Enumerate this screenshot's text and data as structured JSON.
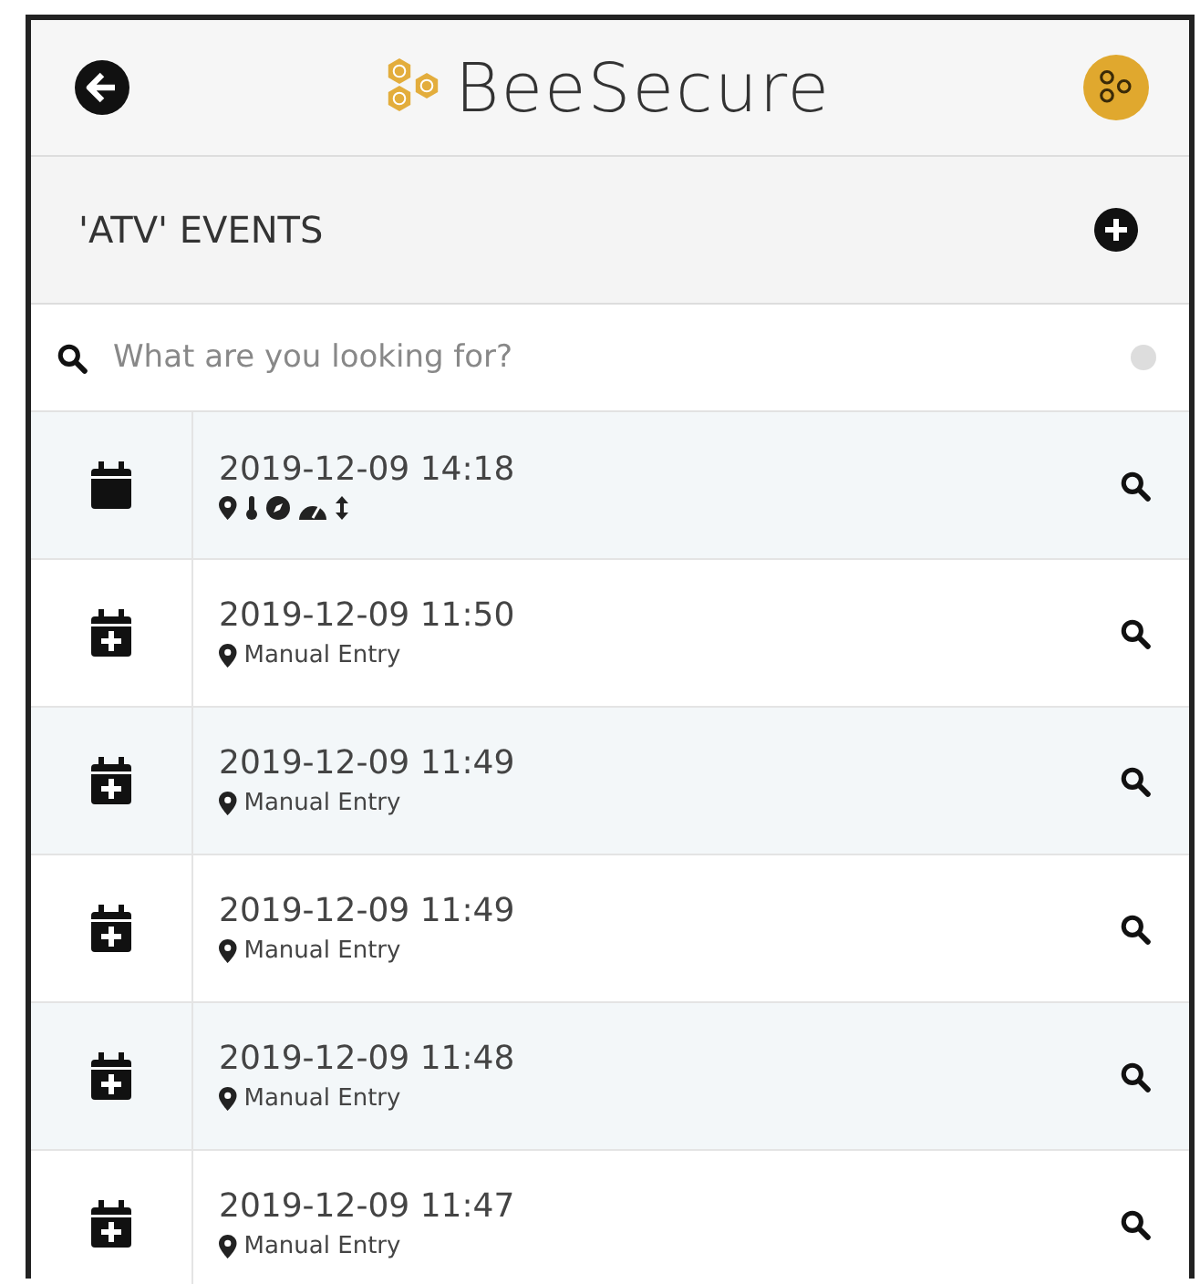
{
  "app": {
    "title": "BeeSecure"
  },
  "section": {
    "title": "'ATV' EVENTS"
  },
  "search": {
    "placeholder": "What are you looking for?"
  },
  "events": [
    {
      "kind": "sensor",
      "time": "2019-12-09 14:18"
    },
    {
      "kind": "manual",
      "time": "2019-12-09 11:50",
      "location": "Manual Entry"
    },
    {
      "kind": "manual",
      "time": "2019-12-09 11:49",
      "location": "Manual Entry"
    },
    {
      "kind": "manual",
      "time": "2019-12-09 11:49",
      "location": "Manual Entry"
    },
    {
      "kind": "manual",
      "time": "2019-12-09 11:48",
      "location": "Manual Entry"
    },
    {
      "kind": "manual",
      "time": "2019-12-09 11:47",
      "location": "Manual Entry"
    }
  ]
}
